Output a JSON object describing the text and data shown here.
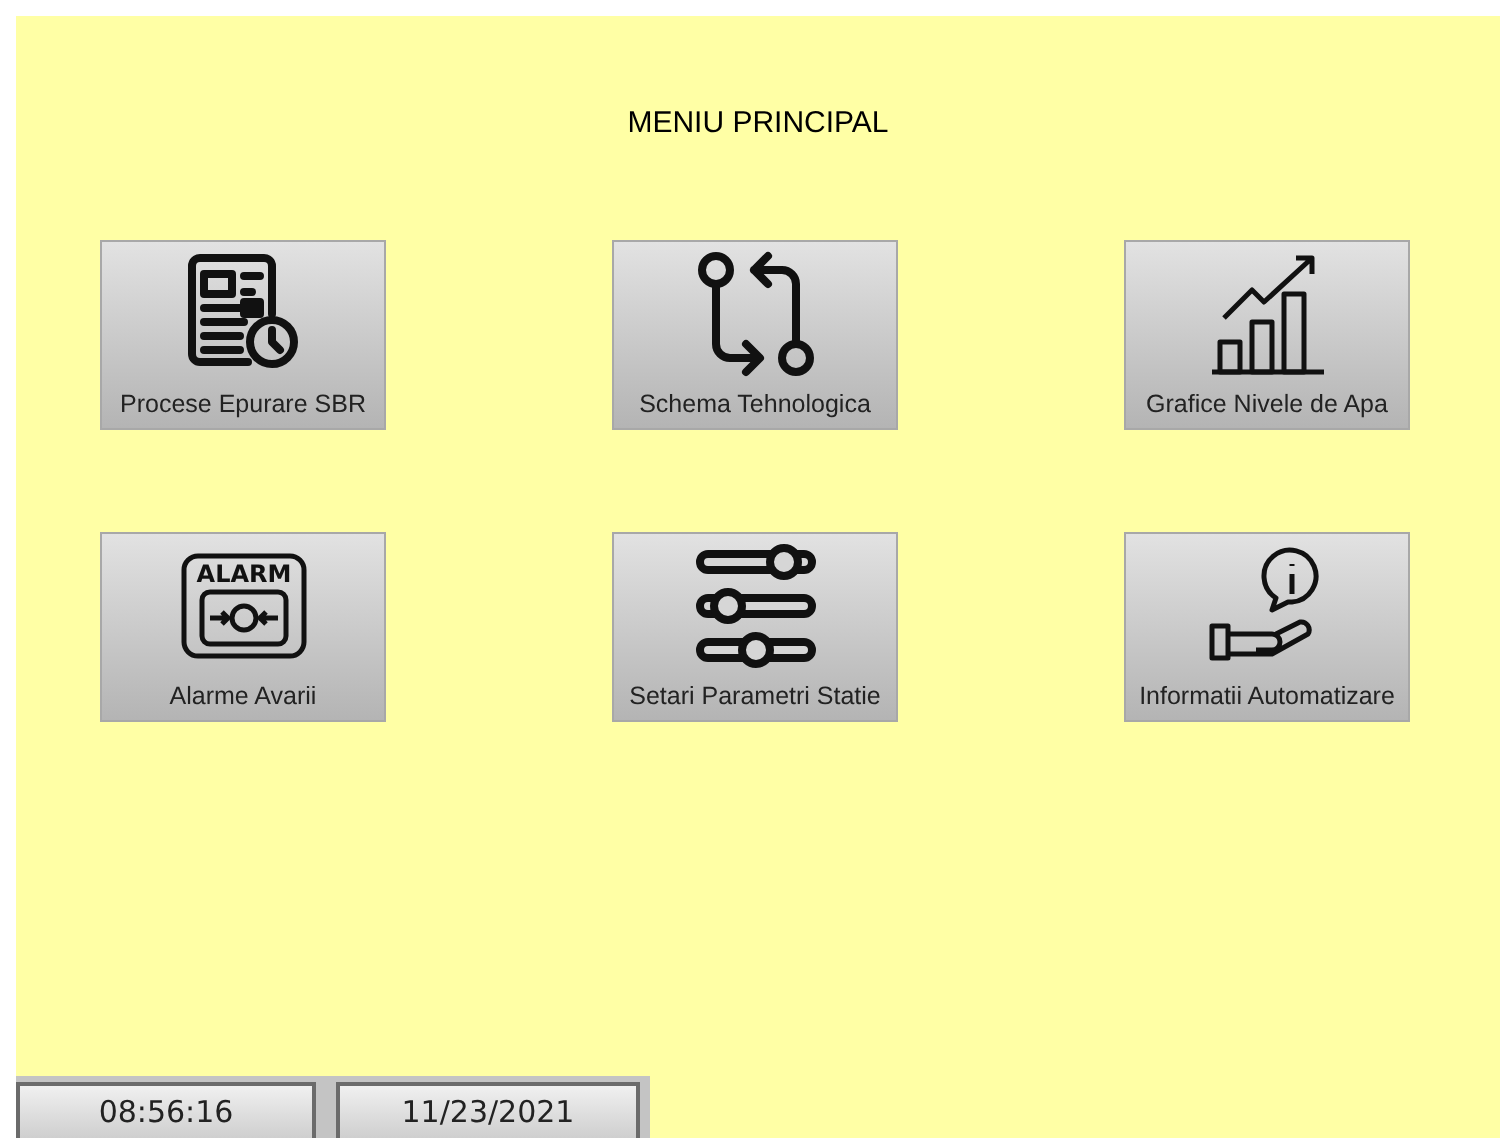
{
  "title": "MENIU PRINCIPAL",
  "buttons": [
    {
      "label": "Procese Epurare SBR"
    },
    {
      "label": "Schema Tehnologica"
    },
    {
      "label": "Grafice Nivele de Apa"
    },
    {
      "label": "Alarme Avarii",
      "icon_text": "ALARM"
    },
    {
      "label": "Setari Parametri Statie"
    },
    {
      "label": "Informatii Automatizare"
    }
  ],
  "status_bar": {
    "time": "08:56:16",
    "date": "11/23/2021"
  }
}
